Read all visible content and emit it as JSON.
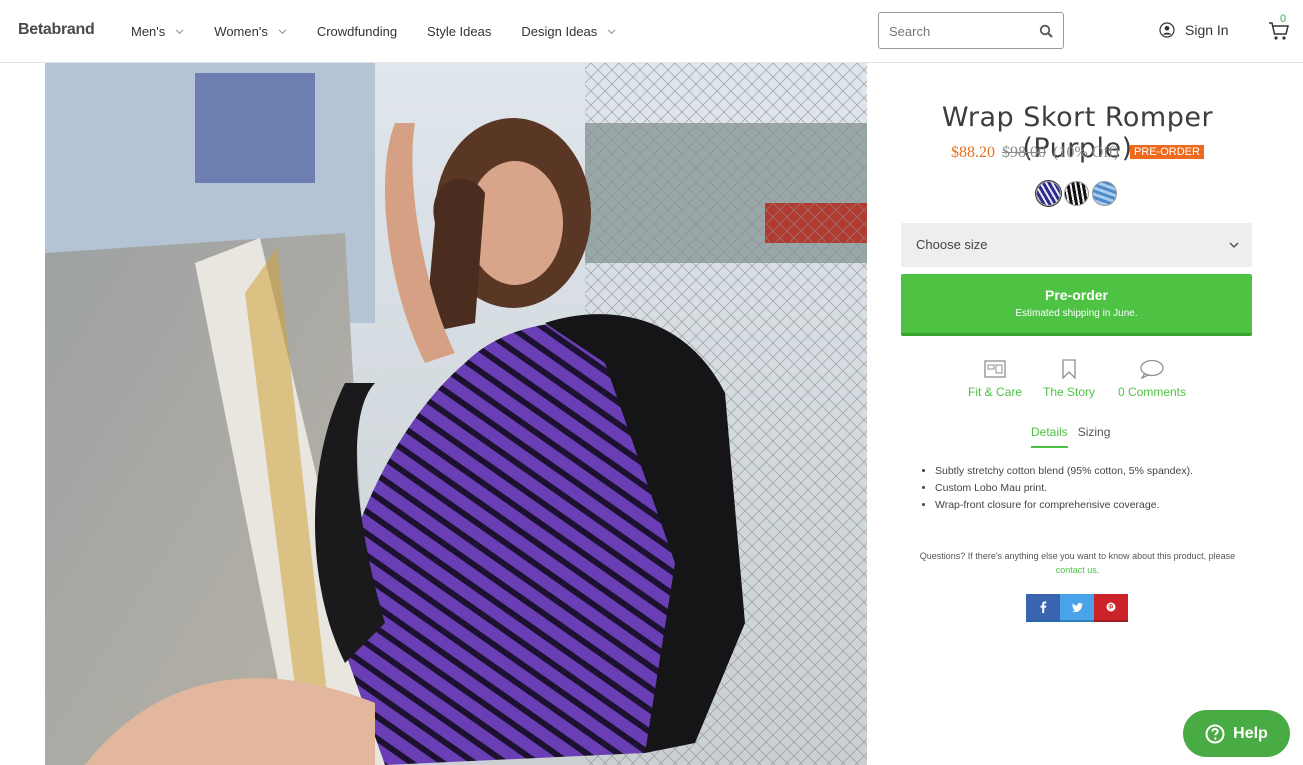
{
  "header": {
    "logo": "Betabrand",
    "nav": [
      {
        "label": "Men's",
        "has_dropdown": true
      },
      {
        "label": "Women's",
        "has_dropdown": true
      },
      {
        "label": "Crowdfunding",
        "has_dropdown": false
      },
      {
        "label": "Style Ideas",
        "has_dropdown": false
      },
      {
        "label": "Design Ideas",
        "has_dropdown": true
      }
    ],
    "search": {
      "placeholder": "Search",
      "icon": "search-icon"
    },
    "signin_label": "Sign In",
    "cart_count": "0"
  },
  "product": {
    "title": "Wrap Skort Romper (Purple)",
    "price_now": "$88.20",
    "price_old": "$98.00",
    "discount": "(10% Off)",
    "badge": "PRE-ORDER",
    "swatches": [
      {
        "name": "Purple zebra",
        "color": "#3a3a9a",
        "selected": true
      },
      {
        "name": "Black zebra",
        "color": "#1e1e1e",
        "selected": false
      },
      {
        "name": "Blue marble",
        "color": "#5a95d0",
        "selected": false
      }
    ],
    "size_select_label": "Choose size",
    "preorder_label": "Pre-order",
    "preorder_sub": "Estimated shipping in June.",
    "actions": [
      {
        "label": "Fit & Care",
        "icon": "fit-care-icon"
      },
      {
        "label": "The Story",
        "icon": "bookmark-icon"
      },
      {
        "label": "0 Comments",
        "icon": "comment-icon"
      }
    ],
    "tabs": [
      {
        "label": "Details",
        "active": true
      },
      {
        "label": "Sizing",
        "active": false
      }
    ],
    "details": [
      "Subtly stretchy cotton blend (95% cotton, 5% spandex).",
      "Custom Lobo Mau print.",
      "Wrap-front closure for comprehensive coverage."
    ],
    "questions_text": "Questions? If there's anything else you want to know about this product, please",
    "contact_link": "contact us",
    "social": [
      "facebook-icon",
      "twitter-icon",
      "pinterest-icon"
    ]
  },
  "help_label": "Help",
  "colors": {
    "accent_green": "#4ec243",
    "price_orange": "#e86f1d",
    "social_blue": "#3b7bc8"
  }
}
